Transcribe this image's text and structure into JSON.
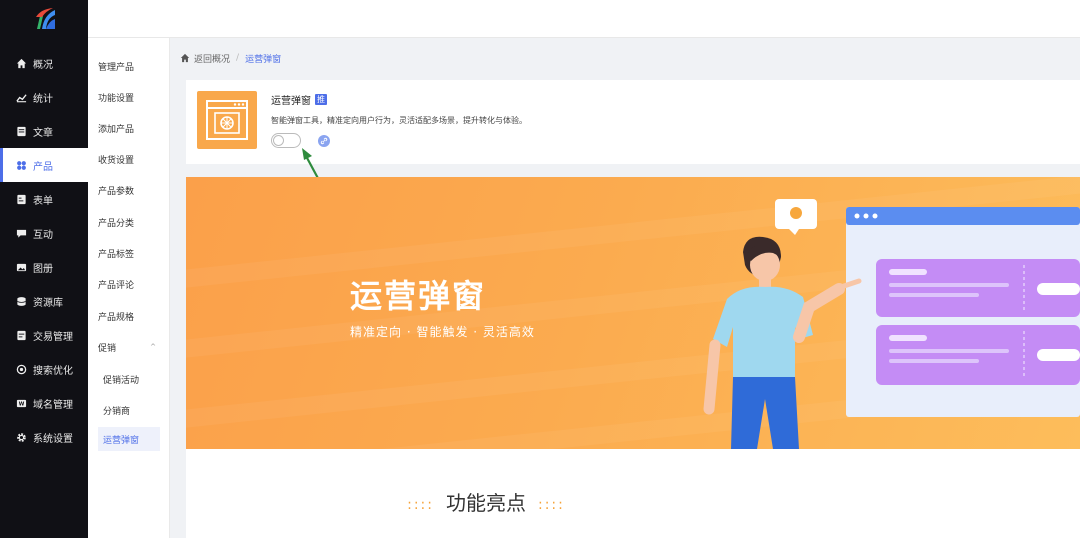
{
  "sidebar": {
    "items": [
      {
        "label": "概况",
        "icon": "home-icon"
      },
      {
        "label": "统计",
        "icon": "stats-icon"
      },
      {
        "label": "文章",
        "icon": "article-icon"
      },
      {
        "label": "产品",
        "icon": "product-icon"
      },
      {
        "label": "表单",
        "icon": "form-icon"
      },
      {
        "label": "互动",
        "icon": "chat-icon"
      },
      {
        "label": "图册",
        "icon": "album-icon"
      },
      {
        "label": "资源库",
        "icon": "database-icon"
      },
      {
        "label": "交易管理",
        "icon": "trade-icon"
      },
      {
        "label": "搜索优化",
        "icon": "seo-icon"
      },
      {
        "label": "域名管理",
        "icon": "domain-icon"
      },
      {
        "label": "系统设置",
        "icon": "gear-icon"
      }
    ],
    "active_index": 3
  },
  "submenu": {
    "items": [
      {
        "label": "管理产品"
      },
      {
        "label": "功能设置"
      },
      {
        "label": "添加产品"
      },
      {
        "label": "收货设置"
      },
      {
        "label": "产品参数"
      },
      {
        "label": "产品分类"
      },
      {
        "label": "产品标签"
      },
      {
        "label": "产品评论"
      },
      {
        "label": "产品规格"
      },
      {
        "label": "促销"
      },
      {
        "label": "促销活动"
      },
      {
        "label": "分销商"
      },
      {
        "label": "运营弹窗"
      }
    ],
    "promo_arrow": "^"
  },
  "breadcrumb": {
    "back": "返回概况",
    "separator": "/",
    "current": "运营弹窗"
  },
  "plugin": {
    "title": "运营弹窗",
    "badge": "推",
    "description": "智能弹窗工具，精准定向用户行为，灵活适配多场景，提升转化与体验。",
    "enabled": false
  },
  "banner": {
    "title": "运营弹窗",
    "subtitle": "精准定向 · 智能触发 · 灵活高效"
  },
  "features": {
    "title": "功能亮点",
    "dots": "::::"
  },
  "colors": {
    "accent": "#4d6ee8",
    "sidebar_bg": "#101015",
    "banner_orange": "#fba04a",
    "popup_purple": "#c084fc"
  }
}
